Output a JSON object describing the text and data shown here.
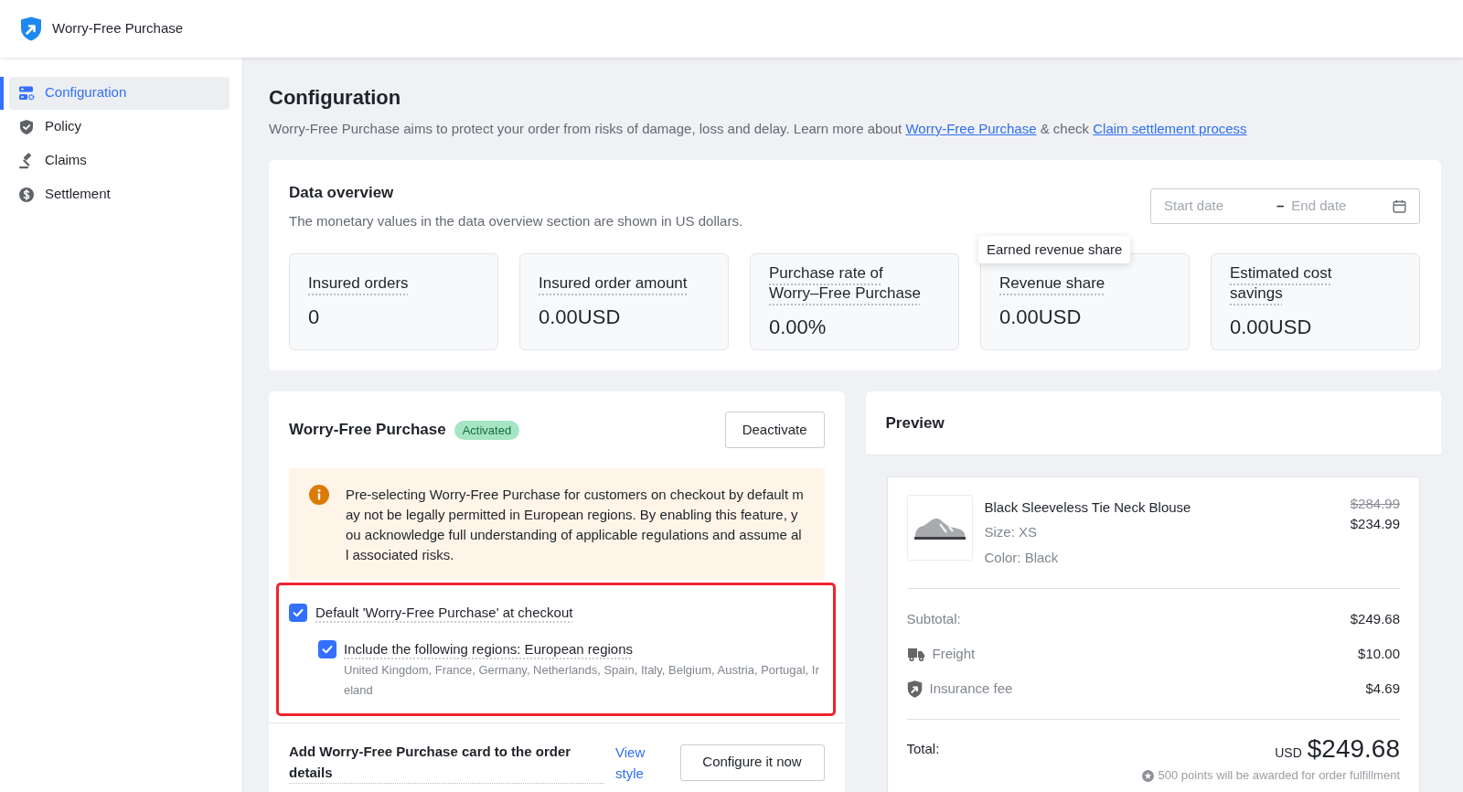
{
  "header": {
    "title": "Worry-Free Purchase"
  },
  "sidebar": {
    "items": [
      {
        "label": "Configuration",
        "selected": true
      },
      {
        "label": "Policy",
        "selected": false
      },
      {
        "label": "Claims",
        "selected": false
      },
      {
        "label": "Settlement",
        "selected": false
      }
    ]
  },
  "page": {
    "title": "Configuration",
    "description": [
      {
        "kind": "text",
        "text": "Worry-Free Purchase aims to protect your order from risks of damage, loss and delay. Learn more about "
      },
      {
        "kind": "link",
        "text": "Worry-Free Purchase"
      },
      {
        "kind": "text",
        "text": " & check "
      },
      {
        "kind": "link",
        "text": "Claim settlement process"
      }
    ]
  },
  "data_overview": {
    "title": "Data overview",
    "subtitle": "The monetary values in the data overview section are shown in US dollars.",
    "date_range": {
      "start_placeholder": "Start date",
      "separator": "–",
      "end_placeholder": "End date"
    },
    "stats": [
      {
        "label": "Insured orders",
        "value": "0"
      },
      {
        "label": "Insured order amount",
        "value": "0.00USD"
      },
      {
        "label": "Purchase rate of Worry–Free Purchase",
        "value": "0.00%"
      },
      {
        "label": "Revenue share",
        "value": "0.00USD",
        "tooltip": "Earned revenue share"
      },
      {
        "label": "Estimated cost savings",
        "value": "0.00USD"
      }
    ]
  },
  "feature": {
    "title": "Worry-Free Purchase",
    "status": "Activated",
    "action": "Deactivate",
    "warning": "Pre-selecting Worry-Free Purchase for customers on checkout by default may not be legally permitted in European regions. By enabling this feature, you acknowledge full understanding of applicable regulations and assume all associated risks.",
    "highlighted": true,
    "options": [
      {
        "label": "Default 'Worry-Free Purchase' at checkout",
        "checked": true,
        "children": [
          {
            "label": "Include the following regions: European regions",
            "checked": true,
            "detail": "United Kingdom, France, Germany, Netherlands, Spain, Italy, Belgium, Austria, Portugal, Ireland"
          }
        ]
      }
    ],
    "order_card": {
      "label": "Add Worry-Free Purchase card to the order details",
      "link": "View style",
      "action": "Configure it now"
    }
  },
  "preview": {
    "title": "Preview",
    "product": {
      "name": "Black Sleeveless Tie Neck Blouse",
      "size": "Size: XS",
      "color_label": "Color: Black",
      "original_price": "$284.99",
      "price": "$234.99"
    },
    "lines": [
      {
        "kind": "subtotal",
        "label": "Subtotal:",
        "value": "$249.68"
      },
      {
        "kind": "freight",
        "label": "Freight",
        "value": "$10.00"
      },
      {
        "kind": "insurance",
        "label": "Insurance fee",
        "value": "$4.69"
      }
    ],
    "total": {
      "label": "Total:",
      "currency": "USD",
      "amount": "$249.68"
    },
    "points_note": "500 points will be awarded for order fulfillment"
  }
}
